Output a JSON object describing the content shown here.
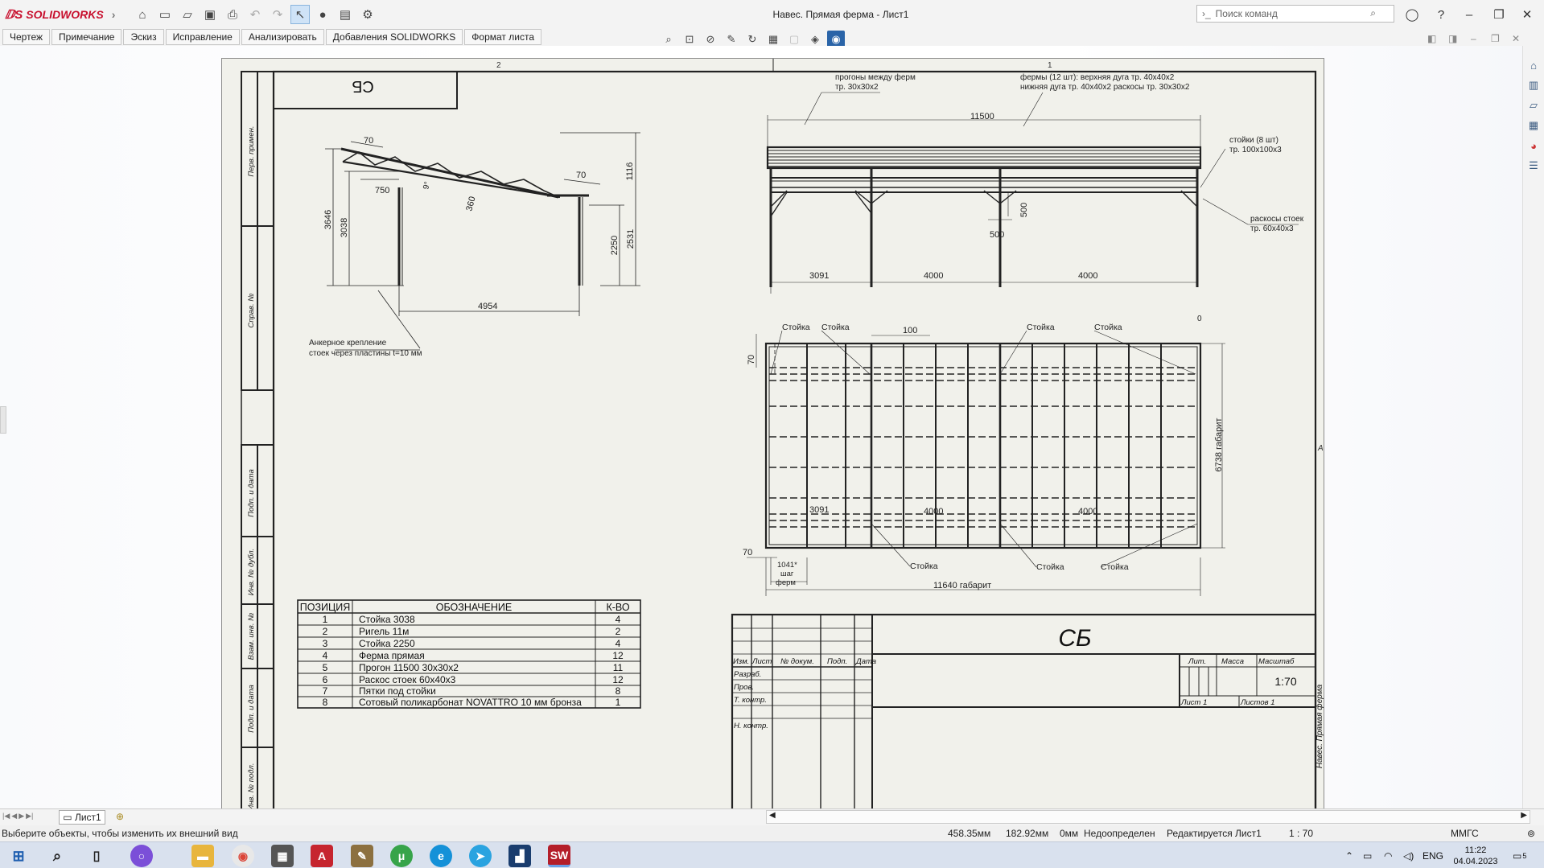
{
  "app": {
    "brand": "SOLIDWORKS",
    "window_title": "Навес. Прямая ферма - Лист1",
    "search_placeholder": "Поиск команд"
  },
  "tabs": [
    "Чертеж",
    "Примечание",
    "Эскиз",
    "Исправление",
    "Анализировать",
    "Добавления SOLIDWORKS",
    "Формат листа"
  ],
  "drawing": {
    "zone_top": [
      "2",
      "1"
    ],
    "zone_right": "A",
    "stamp_small": "СБ",
    "side_labels": [
      "Перв. примен.",
      "Справ. №",
      "Подп. и дата",
      "Инв. № дубл.",
      "Взам. инв. №",
      "Подп. и дата",
      "Инв. № подл."
    ],
    "side_view": {
      "dims": [
        "70",
        "750",
        "9°",
        "360",
        "70",
        "1116",
        "3646",
        "3038",
        "2250",
        "2531",
        "4954"
      ],
      "anchor_note": [
        "Анкерное крепление",
        "стоек через пластины t=10 мм"
      ]
    },
    "front_view": {
      "note_purlins": [
        "прогоны между ферм",
        "тр. 30x30x2"
      ],
      "note_trusses": [
        "фермы (12 шт): верхняя дуга тр. 40x40x2",
        "нижняя дуга тр. 40x40x2 раскосы тр. 30x30x2"
      ],
      "note_posts": [
        "стойки (8 шт)",
        "тр. 100x100x3"
      ],
      "note_braces": [
        "раскосы стоек",
        "тр. 60x40x3"
      ],
      "dims": [
        "11500",
        "3091",
        "4000",
        "4000",
        "500",
        "500"
      ]
    },
    "plan_view": {
      "callout": "Стойка",
      "dims": [
        "100",
        "70",
        "3091",
        "4000",
        "4000",
        "70",
        "6738 габарит",
        "11640 габарит",
        "0"
      ],
      "pitch_note": [
        "1041*",
        "шаг",
        "ферм"
      ]
    },
    "bom": {
      "headers": [
        "ПОЗИЦИЯ",
        "ОБОЗНАЧЕНИЕ",
        "К-ВО"
      ],
      "rows": [
        [
          "1",
          "Стойка 3038",
          "4"
        ],
        [
          "2",
          "Ригель 11м",
          "2"
        ],
        [
          "3",
          "Стойка 2250",
          "4"
        ],
        [
          "4",
          "Ферма прямая",
          "12"
        ],
        [
          "5",
          "Прогон 11500 30x30x2",
          "11"
        ],
        [
          "6",
          "Раскос стоек 60x40x3",
          "12"
        ],
        [
          "7",
          "Пятки под стойки",
          "8"
        ],
        [
          "8",
          "Сотовый поликарбонат NOVATTRO 10 мм бронза",
          "1"
        ]
      ]
    },
    "title_block": {
      "designation": "СБ",
      "col_heads": [
        "Изм.",
        "Лист",
        "№ докум.",
        "Подп.",
        "Дата"
      ],
      "roles": [
        "Разраб.",
        "Пров.",
        "Т. контр.",
        "Н. контр."
      ],
      "lit": "Лит.",
      "mass": "Масса",
      "scale_label": "Масштаб",
      "scale": "1:70",
      "sheet": "Лист 1",
      "sheets": "Листов 1",
      "vertical_name": "Навес. Прямая ферма"
    }
  },
  "sheet_tab": "Лист1",
  "status": {
    "hint": "Выберите объекты, чтобы изменить их внешний вид",
    "x": "458.35мм",
    "y": "182.92мм",
    "z": "0мм",
    "state": "Недоопределен",
    "editing": "Редактируется Лист1",
    "scale": "1 : 70",
    "units": "ММГС"
  },
  "tray": {
    "lang": "ENG",
    "time": "11:22",
    "date": "04.04.2023",
    "notif": "5"
  },
  "colors": {
    "brand_red": "#c8102e",
    "sheet_bg": "#f1f1eb",
    "highlight": "#2a64a8"
  }
}
